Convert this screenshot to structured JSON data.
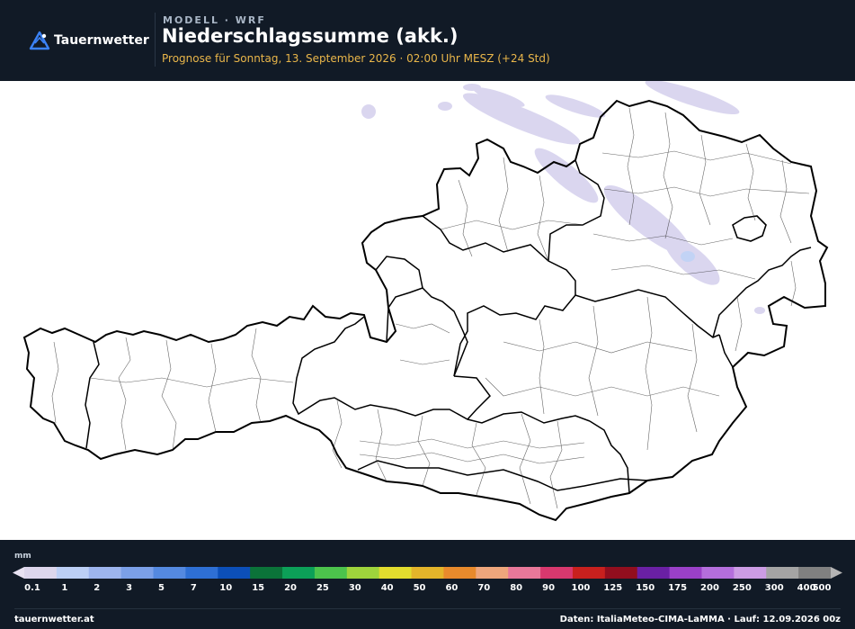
{
  "header": {
    "brand": "Tauernwetter",
    "model_label": "MODELL · WRF",
    "title": "Niederschlagssumme (akk.)",
    "subtitle": "Prognose für Sonntag, 13. September 2026 · 02:00 Uhr MESZ  (+24 Std)"
  },
  "legend": {
    "unit": "mm",
    "ticks": [
      "0.1",
      "1",
      "2",
      "3",
      "5",
      "7",
      "10",
      "15",
      "20",
      "25",
      "30",
      "40",
      "50",
      "60",
      "70",
      "80",
      "90",
      "100",
      "125",
      "150",
      "175",
      "200",
      "250",
      "300",
      "400",
      "500"
    ],
    "colors": [
      "#dcd6ec",
      "#bccff5",
      "#9db5ee",
      "#7ba0e8",
      "#5489e0",
      "#2e6fd4",
      "#0c4fb8",
      "#0b7339",
      "#0ca058",
      "#4cc34c",
      "#9ed43c",
      "#e2dc2e",
      "#e4b42a",
      "#e88a2c",
      "#eea67c",
      "#e8789a",
      "#d8386e",
      "#c8201e",
      "#920e1e",
      "#6a20a4",
      "#9a40c8",
      "#b46edc",
      "#cc9ce4",
      "#a4a4a4",
      "#808080"
    ],
    "start_color": "#e8e2f2",
    "end_color": "#b4b4b4"
  },
  "icons": {
    "logo": "mountain-logo-icon"
  },
  "colors": {
    "header_bg": "#111a26",
    "accent": "#e9b64a",
    "precip": "#d6d2ee"
  },
  "footer": {
    "left": "tauernwetter.at",
    "right": "Daten: ItaliaMeteo-CIMA-LaMMA · Lauf: 12.09.2026 00z"
  }
}
